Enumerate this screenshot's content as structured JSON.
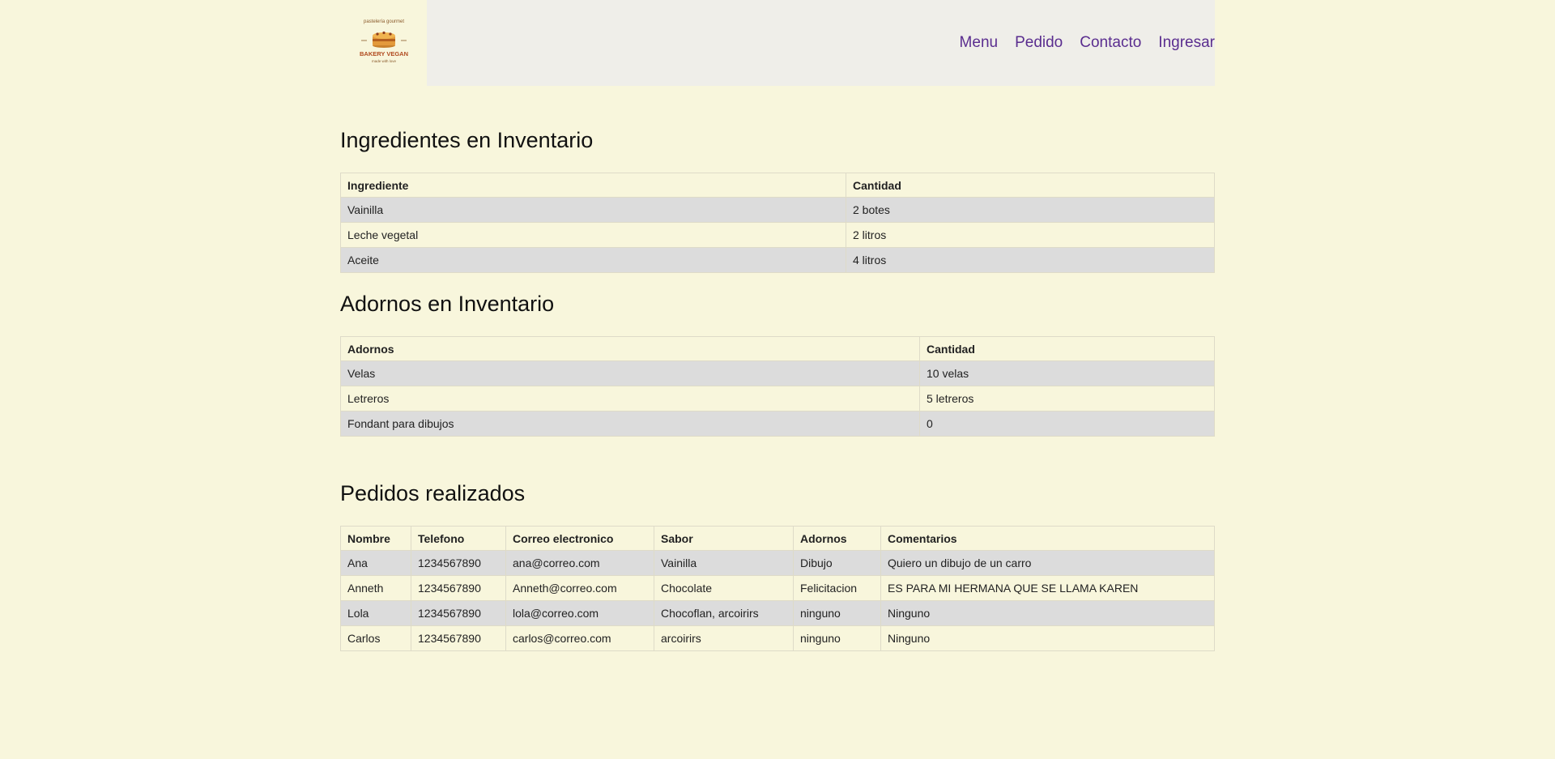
{
  "logo": {
    "top_text": "pastelería gourmet",
    "brand": "BAKERY VEGAN",
    "tagline": "made with love"
  },
  "nav": {
    "items": [
      "Menu",
      "Pedido",
      "Contacto",
      "Ingresar"
    ]
  },
  "ingredientes": {
    "title": "Ingredientes en Inventario",
    "headers": [
      "Ingrediente",
      "Cantidad"
    ],
    "rows": [
      [
        "Vainilla",
        "2 botes"
      ],
      [
        "Leche vegetal",
        "2 litros"
      ],
      [
        "Aceite",
        "4 litros"
      ]
    ]
  },
  "adornos": {
    "title": "Adornos en Inventario",
    "headers": [
      "Adornos",
      "Cantidad"
    ],
    "rows": [
      [
        "Velas",
        "10 velas"
      ],
      [
        "Letreros",
        "5 letreros"
      ],
      [
        "Fondant para dibujos",
        "0"
      ]
    ]
  },
  "pedidos": {
    "title": "Pedidos realizados",
    "headers": [
      "Nombre",
      "Telefono",
      "Correo electronico",
      "Sabor",
      "Adornos",
      "Comentarios"
    ],
    "rows": [
      [
        "Ana",
        "1234567890",
        "ana@correo.com",
        "Vainilla",
        "Dibujo",
        "Quiero un dibujo de un carro"
      ],
      [
        "Anneth",
        "1234567890",
        "Anneth@correo.com",
        "Chocolate",
        "Felicitacion",
        "ES PARA MI HERMANA QUE SE LLAMA KAREN"
      ],
      [
        "Lola",
        "1234567890",
        "lola@correo.com",
        "Chocoflan, arcoirirs",
        "ninguno",
        "Ninguno"
      ],
      [
        "Carlos",
        "1234567890",
        "carlos@correo.com",
        "arcoirirs",
        "ninguno",
        "Ninguno"
      ]
    ]
  }
}
